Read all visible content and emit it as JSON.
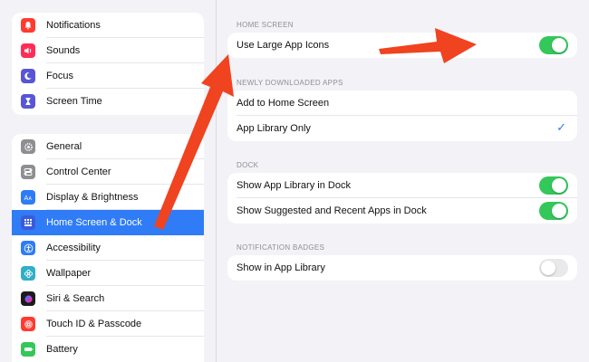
{
  "sidebar": {
    "group1": [
      {
        "label": "Notifications",
        "icon": "bell-icon",
        "color": "#ff3b30"
      },
      {
        "label": "Sounds",
        "icon": "speaker-icon",
        "color": "#ff2d55"
      },
      {
        "label": "Focus",
        "icon": "moon-icon",
        "color": "#5856d6"
      },
      {
        "label": "Screen Time",
        "icon": "hourglass-icon",
        "color": "#5856d6"
      }
    ],
    "group2": [
      {
        "label": "General",
        "icon": "gear-icon",
        "color": "#8e8e93"
      },
      {
        "label": "Control Center",
        "icon": "switches-icon",
        "color": "#8e8e93"
      },
      {
        "label": "Display & Brightness",
        "icon": "text-size-icon",
        "color": "#2f7cf6"
      },
      {
        "label": "Home Screen & Dock",
        "icon": "grid-icon",
        "color": "#3b5bdb",
        "selected": true
      },
      {
        "label": "Accessibility",
        "icon": "accessibility-icon",
        "color": "#2f7cf6"
      },
      {
        "label": "Wallpaper",
        "icon": "flower-icon",
        "color": "#30b0c7"
      },
      {
        "label": "Siri & Search",
        "icon": "siri-icon",
        "color": "#1c1c1e"
      },
      {
        "label": "Touch ID & Passcode",
        "icon": "fingerprint-icon",
        "color": "#ff3b30"
      },
      {
        "label": "Battery",
        "icon": "battery-icon",
        "color": "#34c759"
      }
    ]
  },
  "main": {
    "home_screen": {
      "title": "HOME SCREEN",
      "use_large_icons_label": "Use Large App Icons",
      "use_large_icons_on": true
    },
    "newly_downloaded": {
      "title": "NEWLY DOWNLOADED APPS",
      "add_to_home_label": "Add to Home Screen",
      "app_library_only_label": "App Library Only",
      "selected": "App Library Only"
    },
    "dock": {
      "title": "DOCK",
      "show_app_library_label": "Show App Library in Dock",
      "show_app_library_on": true,
      "show_suggested_label": "Show Suggested and Recent Apps in Dock",
      "show_suggested_on": true
    },
    "badges": {
      "title": "NOTIFICATION BADGES",
      "show_in_library_label": "Show in App Library",
      "show_in_library_on": false
    }
  },
  "colors": {
    "accent": "#2f7cf6",
    "toggle_on": "#34c759",
    "annotation_arrow": "#f0431f"
  }
}
